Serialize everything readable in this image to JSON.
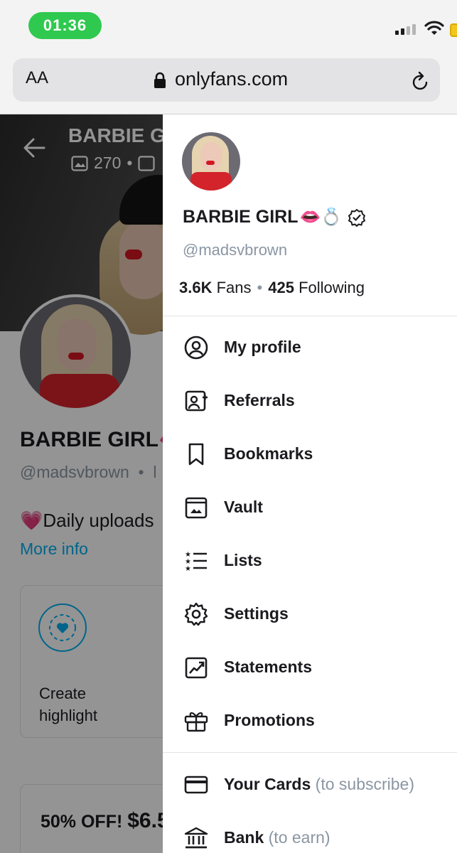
{
  "status_bar": {
    "time": "01:36"
  },
  "browser": {
    "text_size_label": "AA",
    "url": "onlyfans.com"
  },
  "profile": {
    "cover_title": "BARBIE G",
    "photos_count": "270",
    "name": "BARBIE GIRL",
    "handle": "@madsvbrown",
    "bio": "Daily uploads",
    "bio_emoji": "💗",
    "more_info": "More info",
    "highlight_label": "Create highlight",
    "promo_prefix": "50% OFF!",
    "promo_price": "$6.5"
  },
  "drawer": {
    "name": "BARBIE GIRL",
    "name_emojis": "👄💍",
    "handle": "@madsvbrown",
    "fans_count": "3.6K",
    "fans_label": "Fans",
    "following_count": "425",
    "following_label": "Following",
    "menu": [
      {
        "label": "My profile",
        "icon": "user-circle-icon"
      },
      {
        "label": "Referrals",
        "icon": "referrals-icon"
      },
      {
        "label": "Bookmarks",
        "icon": "bookmark-icon"
      },
      {
        "label": "Vault",
        "icon": "vault-icon"
      },
      {
        "label": "Lists",
        "icon": "lists-icon"
      },
      {
        "label": "Settings",
        "icon": "gear-icon"
      },
      {
        "label": "Statements",
        "icon": "statements-icon"
      },
      {
        "label": "Promotions",
        "icon": "gift-icon"
      }
    ],
    "payments": [
      {
        "label": "Your Cards",
        "note": "(to subscribe)",
        "icon": "card-icon"
      },
      {
        "label": "Bank",
        "note": "(to earn)",
        "icon": "bank-icon"
      }
    ]
  },
  "colors": {
    "accent": "#00aff0",
    "status_green": "#2fc94f",
    "muted": "#8a96a3"
  }
}
